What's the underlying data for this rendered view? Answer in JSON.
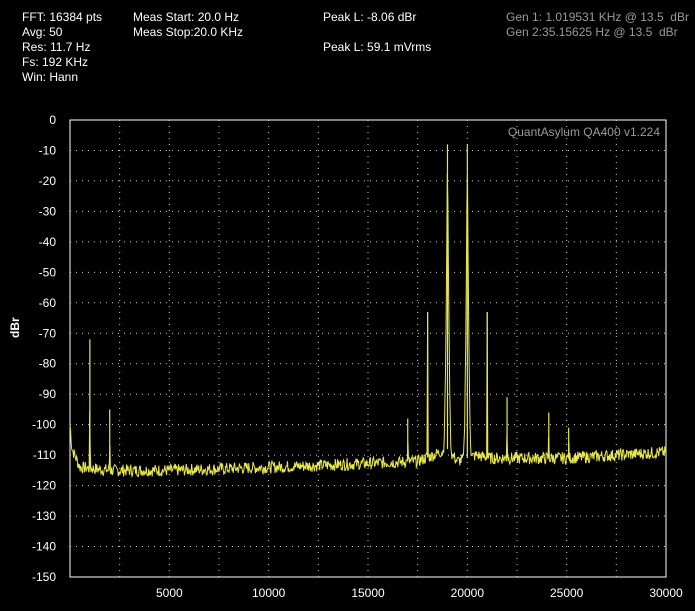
{
  "readouts": {
    "fft": "FFT: 16384 pts",
    "avg": "Avg: 50",
    "res": "Res: 11.7 Hz",
    "fs": "Fs: 192 KHz",
    "win": "Win: Hann",
    "meas_start": "Meas Start: 20.0 Hz",
    "meas_stop": "Meas Stop:20.0 KHz",
    "peak_l_dbr": "Peak L: -8.06 dBr",
    "peak_l_mvrms": "Peak L: 59.1 mVrms",
    "gen1": "Gen 1: 1.019531 KHz @ 13.5  dBr",
    "gen2": "Gen 2:35.15625 Hz @ 13.5  dBr"
  },
  "chart_data": {
    "type": "line",
    "watermark": "QuantAsylum QA400 v1.224",
    "ylabel": "dBr",
    "xlabel": "",
    "xlim": [
      0,
      30000
    ],
    "ylim": [
      -150,
      0
    ],
    "x_ticks": [
      "5000",
      "10000",
      "15000",
      "20000",
      "25000",
      "30000"
    ],
    "y_ticks": [
      "0",
      "-10",
      "-20",
      "-30",
      "-40",
      "-50",
      "-60",
      "-70",
      "-80",
      "-90",
      "-100",
      "-110",
      "-120",
      "-130",
      "-140",
      "-150"
    ],
    "grid": true,
    "line_color": "#e8e84a",
    "series": [
      {
        "noise_floor": [
          [
            0,
            -100
          ],
          [
            100,
            -108
          ],
          [
            500,
            -114
          ],
          [
            2000,
            -115
          ],
          [
            5000,
            -115
          ],
          [
            10000,
            -114
          ],
          [
            14000,
            -113
          ],
          [
            17500,
            -112
          ],
          [
            18300,
            -110
          ],
          [
            19000,
            -108
          ],
          [
            19500,
            -112
          ],
          [
            20500,
            -110
          ],
          [
            21000,
            -111
          ],
          [
            25000,
            -111
          ],
          [
            30000,
            -109
          ]
        ],
        "peaks": [
          [
            1000,
            -72
          ],
          [
            2000,
            -95
          ],
          [
            17000,
            -98
          ],
          [
            18000,
            -63
          ],
          [
            19000,
            -8
          ],
          [
            20000,
            -8
          ],
          [
            21000,
            -63
          ],
          [
            22000,
            -91
          ],
          [
            24100,
            -96
          ],
          [
            25100,
            -101
          ]
        ]
      }
    ]
  }
}
